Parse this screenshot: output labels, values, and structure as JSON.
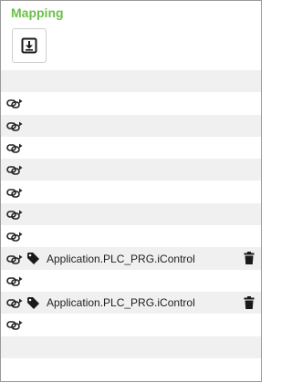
{
  "panel": {
    "title": "Mapping",
    "download_button": {
      "icon": "download-icon"
    }
  },
  "colors": {
    "title": "#6cc04a",
    "row_shade": "#f0f0f0",
    "icon": "#222222"
  },
  "rows": [
    {
      "shaded": true,
      "link_icon": false,
      "variable": ""
    },
    {
      "shaded": false,
      "link_icon": true,
      "variable": ""
    },
    {
      "shaded": true,
      "link_icon": true,
      "variable": ""
    },
    {
      "shaded": false,
      "link_icon": true,
      "variable": ""
    },
    {
      "shaded": true,
      "link_icon": true,
      "variable": ""
    },
    {
      "shaded": false,
      "link_icon": true,
      "variable": ""
    },
    {
      "shaded": true,
      "link_icon": true,
      "variable": ""
    },
    {
      "shaded": false,
      "link_icon": true,
      "variable": ""
    },
    {
      "shaded": true,
      "link_icon": true,
      "variable": "Application.PLC_PRG.iControl"
    },
    {
      "shaded": false,
      "link_icon": true,
      "variable": ""
    },
    {
      "shaded": true,
      "link_icon": true,
      "variable": "Application.PLC_PRG.iControl"
    },
    {
      "shaded": false,
      "link_icon": true,
      "variable": ""
    },
    {
      "shaded": true,
      "link_icon": false,
      "variable": ""
    },
    {
      "shaded": false,
      "link_icon": false,
      "variable": ""
    }
  ]
}
